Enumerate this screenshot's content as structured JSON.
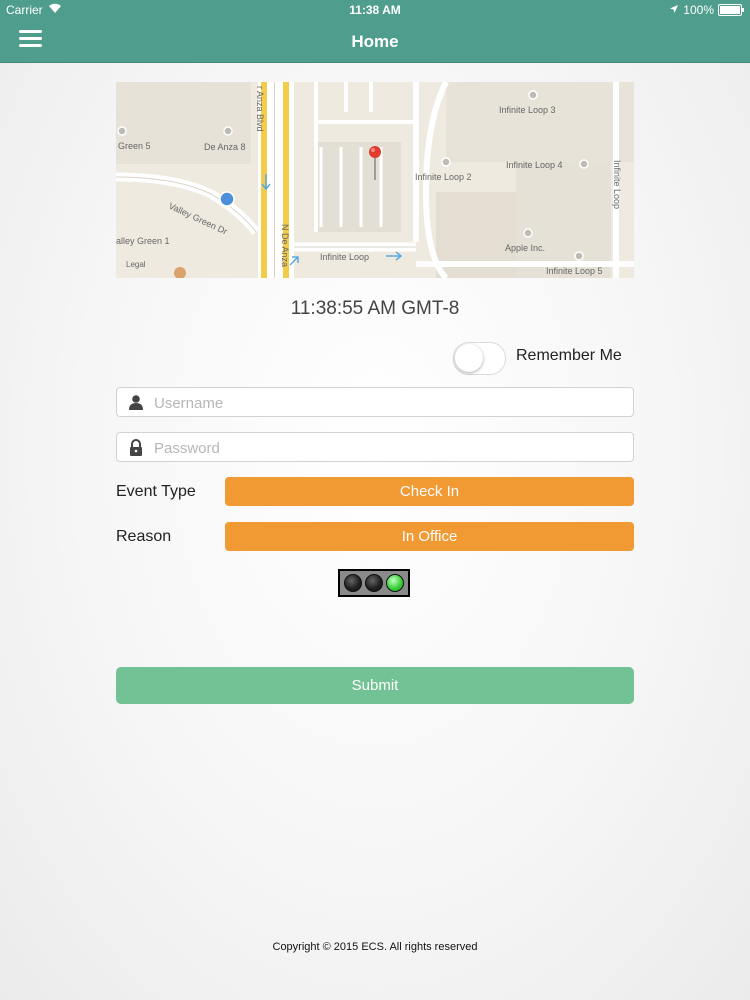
{
  "status_bar": {
    "carrier": "Carrier",
    "time": "11:38 AM",
    "battery": "100%"
  },
  "nav": {
    "title": "Home",
    "bar_color": "#4f9e8d"
  },
  "map": {
    "labels": {
      "green5": "Green 5",
      "deanza8": "De Anza 8",
      "deanza_blvd": "r Anza Blvd",
      "n_deanza": "N De Anza",
      "valley_green_dr": "Valley Green Dr",
      "valley_green1": "alley Green 1",
      "legal": "Legal",
      "infinite_loop": "Infinite Loop",
      "infinite_loop3": "Infinite Loop 3",
      "infinite_loop2": "Infinite Loop 2",
      "infinite_loop4": "Infinite Loop 4",
      "infinite_loop_side": "Infinite Loop",
      "apple_inc": "Apple Inc.",
      "infinite_loop5": "Infinite Loop 5"
    }
  },
  "clock": "11:38:55 AM GMT-8",
  "remember_me": {
    "label": "Remember Me",
    "on": false
  },
  "username": {
    "placeholder": "Username",
    "value": ""
  },
  "password": {
    "placeholder": "Password",
    "value": ""
  },
  "event_type": {
    "label": "Event Type",
    "value": "Check In"
  },
  "reason": {
    "label": "Reason",
    "value": "In Office"
  },
  "status_light": {
    "active": "green"
  },
  "submit_label": "Submit",
  "copyright": "Copyright © 2015 ECS. All rights reserved",
  "colors": {
    "accent": "#4f9e8d",
    "orange": "#f19a34",
    "submit": "#73c295"
  }
}
